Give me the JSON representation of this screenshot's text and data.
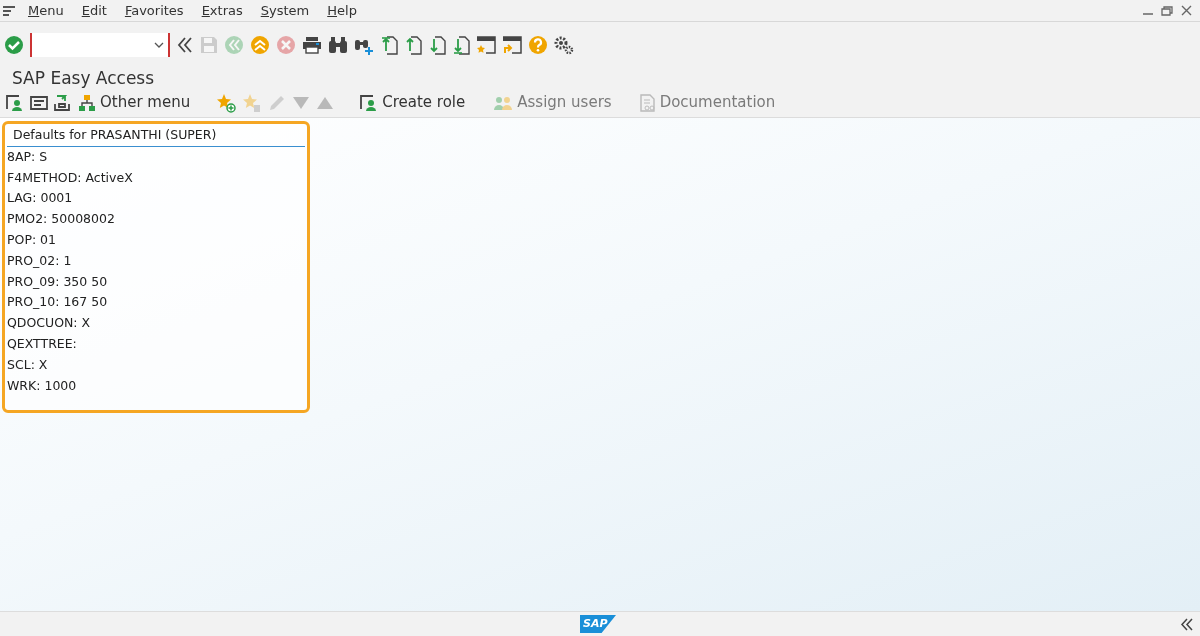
{
  "menu_bar": {
    "items": [
      {
        "label": "Menu"
      },
      {
        "label": "Edit"
      },
      {
        "label": "Favorites"
      },
      {
        "label": "Extras"
      },
      {
        "label": "System"
      },
      {
        "label": "Help"
      }
    ]
  },
  "toolbar": {
    "buttons": [
      {
        "kind": "enter",
        "disabled": false
      },
      {
        "kind": "command-field",
        "disabled": false
      },
      {
        "kind": "collapse",
        "disabled": false
      },
      {
        "kind": "save",
        "disabled": true
      },
      {
        "kind": "back",
        "disabled": true
      },
      {
        "kind": "exit",
        "disabled": false
      },
      {
        "kind": "cancel",
        "disabled": true
      },
      {
        "kind": "print",
        "disabled": false
      },
      {
        "kind": "find",
        "disabled": false
      },
      {
        "kind": "find-next",
        "disabled": false
      },
      {
        "kind": "first-page",
        "disabled": false
      },
      {
        "kind": "prev-page",
        "disabled": false
      },
      {
        "kind": "next-page",
        "disabled": false
      },
      {
        "kind": "last-page",
        "disabled": false
      },
      {
        "kind": "new-session",
        "disabled": false
      },
      {
        "kind": "shortcut",
        "disabled": false
      },
      {
        "kind": "help",
        "disabled": false
      },
      {
        "kind": "settings",
        "disabled": false
      }
    ]
  },
  "screen_title": "SAP Easy Access",
  "app_toolbar": {
    "buttons": [
      {
        "kind": "user-menu",
        "disabled": false
      },
      {
        "kind": "sap-menu",
        "disabled": false
      },
      {
        "kind": "other-user",
        "disabled": false
      },
      {
        "kind": "other-menu",
        "label": "Other menu",
        "disabled": false
      },
      {
        "kind": "add-favorite",
        "disabled": false
      },
      {
        "kind": "delete-favorite",
        "disabled": true
      },
      {
        "kind": "edit",
        "disabled": true
      },
      {
        "kind": "move-down",
        "disabled": true
      },
      {
        "kind": "move-up",
        "disabled": true
      },
      {
        "kind": "create-role",
        "label": "Create role",
        "disabled": false
      },
      {
        "kind": "assign-users",
        "label": "Assign users",
        "disabled": true
      },
      {
        "kind": "documentation",
        "label": "Documentation",
        "disabled": true
      }
    ]
  },
  "defaults_panel": {
    "title": "Defaults for PRASANTHI (SUPER)",
    "entries": [
      "8AP: S",
      "F4METHOD: ActiveX",
      "LAG: 0001",
      "PMO2: 50008002",
      "POP: 01",
      "PRO_02: 1",
      "PRO_09: 350 50",
      "PRO_10: 167 50",
      "QDOCUON: X",
      "QEXTTREE:",
      "SCL: X",
      "WRK: 1000"
    ]
  },
  "status_bar": {
    "logo": "SAP"
  }
}
